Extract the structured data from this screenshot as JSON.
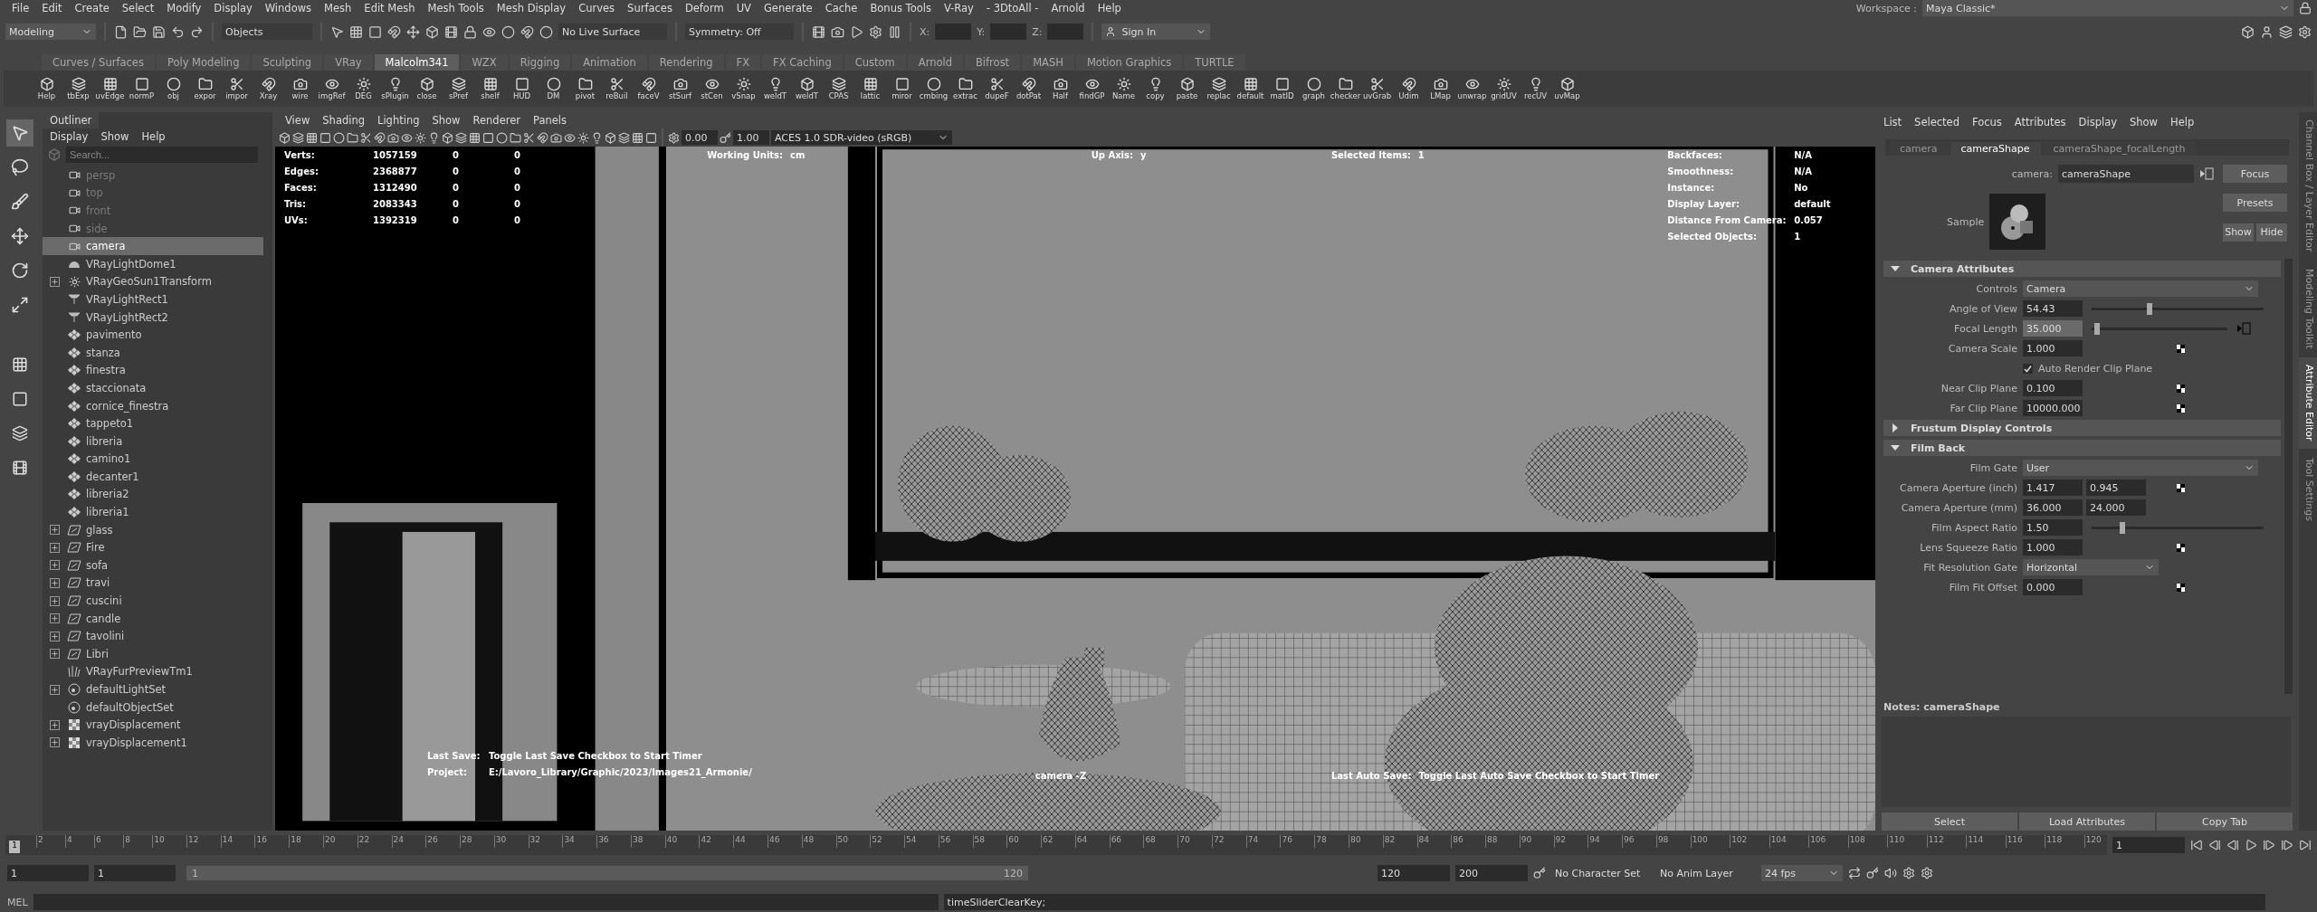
{
  "menu_bar": {
    "items": [
      "File",
      "Edit",
      "Create",
      "Select",
      "Modify",
      "Display",
      "Windows",
      "Mesh",
      "Edit Mesh",
      "Mesh Tools",
      "Mesh Display",
      "Curves",
      "Surfaces",
      "Deform",
      "UV",
      "Generate",
      "Cache",
      "Bonus Tools",
      "V-Ray",
      "- 3DtoAll -",
      "Arnold",
      "Help"
    ],
    "workspace_label": "Workspace :",
    "workspace": "Maya Classic*"
  },
  "status_line": {
    "mode": "Modeling",
    "selection": "Objects",
    "live_surface": "No Live Surface",
    "symmetry": "Symmetry: Off",
    "coords": [
      "X:",
      "Y:",
      "Z:"
    ],
    "sign_in": "Sign In"
  },
  "shelf_tabs": [
    {
      "label": "Curves / Surfaces",
      "selected": false
    },
    {
      "label": "Poly Modeling",
      "selected": false
    },
    {
      "label": "Sculpting",
      "selected": false
    },
    {
      "label": "VRay",
      "selected": false
    },
    {
      "label": "Malcolm341",
      "selected": true
    },
    {
      "label": "WZX",
      "selected": false
    },
    {
      "label": "Rigging",
      "selected": false
    },
    {
      "label": "Animation",
      "selected": false
    },
    {
      "label": "Rendering",
      "selected": false
    },
    {
      "label": "FX",
      "selected": false
    },
    {
      "label": "FX Caching",
      "selected": false
    },
    {
      "label": "Custom",
      "selected": false
    },
    {
      "label": "Arnold",
      "selected": false
    },
    {
      "label": "Bifrost",
      "selected": false
    },
    {
      "label": "MASH",
      "selected": false
    },
    {
      "label": "Motion Graphics",
      "selected": false
    },
    {
      "label": "TURTLE",
      "selected": false
    }
  ],
  "shelf_buttons": [
    "Help",
    "tbExp",
    "uvEdge",
    "normP",
    "obj",
    "expor",
    "impor",
    "Xray",
    "wire",
    "imgRef",
    "DEG",
    "sPlugin",
    "close",
    "sPref",
    "shelf",
    "HUD",
    "DM",
    "pivot",
    "reBuil",
    "faceV",
    "stSurf",
    "stCen",
    "vSnap",
    "weldT",
    "weldT",
    "CPAS",
    "lattic",
    "miror",
    "cmbing",
    "extrac",
    "dupeF",
    "dotPat",
    "Half",
    "findGP",
    "Name",
    "copy",
    "paste",
    "replac",
    "default",
    "matID",
    "graph",
    "checker",
    "uvGrab",
    "Udim",
    "LMap",
    "unwrap",
    "gridUV",
    "recUV",
    "uvMap"
  ],
  "outliner": {
    "title": "Outliner",
    "menu": [
      "Display",
      "Show",
      "Help"
    ],
    "search": {
      "placeholder": "Search..."
    },
    "items": [
      {
        "label": "persp",
        "kind": "camera",
        "has_children": false,
        "dimmed": true,
        "selected": false
      },
      {
        "label": "top",
        "kind": "camera",
        "has_children": false,
        "dimmed": true,
        "selected": false
      },
      {
        "label": "front",
        "kind": "camera",
        "has_children": false,
        "dimmed": true,
        "selected": false
      },
      {
        "label": "side",
        "kind": "camera",
        "has_children": false,
        "dimmed": true,
        "selected": false
      },
      {
        "label": "camera",
        "kind": "camera",
        "has_children": false,
        "dimmed": false,
        "selected": true
      },
      {
        "label": "VRayLightDome1",
        "kind": "dome",
        "has_children": false,
        "dimmed": false,
        "selected": false
      },
      {
        "label": "VRayGeoSun1Transform",
        "kind": "sun",
        "has_children": true,
        "dimmed": false,
        "selected": false
      },
      {
        "label": "VRayLightRect1",
        "kind": "rectlight",
        "has_children": false,
        "dimmed": false,
        "selected": false
      },
      {
        "label": "VRayLightRect2",
        "kind": "rectlight",
        "has_children": false,
        "dimmed": false,
        "selected": false
      },
      {
        "label": "pavimento",
        "kind": "mesh",
        "has_children": false,
        "dimmed": false,
        "selected": false
      },
      {
        "label": "stanza",
        "kind": "mesh",
        "has_children": false,
        "dimmed": false,
        "selected": false
      },
      {
        "label": "finestra",
        "kind": "mesh",
        "has_children": false,
        "dimmed": false,
        "selected": false
      },
      {
        "label": "staccionata",
        "kind": "mesh",
        "has_children": false,
        "dimmed": false,
        "selected": false
      },
      {
        "label": "cornice_finestra",
        "kind": "mesh",
        "has_children": false,
        "dimmed": false,
        "selected": false
      },
      {
        "label": "tappeto1",
        "kind": "mesh",
        "has_children": false,
        "dimmed": false,
        "selected": false
      },
      {
        "label": "libreria",
        "kind": "mesh",
        "has_children": false,
        "dimmed": false,
        "selected": false
      },
      {
        "label": "camino1",
        "kind": "mesh",
        "has_children": false,
        "dimmed": false,
        "selected": false
      },
      {
        "label": "decanter1",
        "kind": "mesh",
        "has_children": false,
        "dimmed": false,
        "selected": false
      },
      {
        "label": "libreria2",
        "kind": "mesh",
        "has_children": false,
        "dimmed": false,
        "selected": false
      },
      {
        "label": "libreria1",
        "kind": "mesh",
        "has_children": false,
        "dimmed": false,
        "selected": false
      },
      {
        "label": "glass",
        "kind": "group",
        "has_children": true,
        "dimmed": false,
        "selected": false
      },
      {
        "label": "Fire",
        "kind": "group",
        "has_children": true,
        "dimmed": false,
        "selected": false
      },
      {
        "label": "sofa",
        "kind": "group",
        "has_children": true,
        "dimmed": false,
        "selected": false
      },
      {
        "label": "travi",
        "kind": "group",
        "has_children": true,
        "dimmed": false,
        "selected": false
      },
      {
        "label": "cuscini",
        "kind": "group",
        "has_children": true,
        "dimmed": false,
        "selected": false
      },
      {
        "label": "candle",
        "kind": "group",
        "has_children": true,
        "dimmed": false,
        "selected": false
      },
      {
        "label": "tavolini",
        "kind": "group",
        "has_children": true,
        "dimmed": false,
        "selected": false
      },
      {
        "label": "Libri",
        "kind": "group",
        "has_children": true,
        "dimmed": false,
        "selected": false
      },
      {
        "label": "VRayFurPreviewTm1",
        "kind": "fur",
        "has_children": false,
        "dimmed": false,
        "selected": false
      },
      {
        "label": "defaultLightSet",
        "kind": "set",
        "has_children": true,
        "dimmed": false,
        "selected": false
      },
      {
        "label": "defaultObjectSet",
        "kind": "set",
        "has_children": false,
        "dimmed": false,
        "selected": false
      },
      {
        "label": "vrayDisplacement",
        "kind": "displacement",
        "has_children": true,
        "dimmed": false,
        "selected": false
      },
      {
        "label": "vrayDisplacement1",
        "kind": "displacement",
        "has_children": true,
        "dimmed": false,
        "selected": false
      }
    ]
  },
  "viewport": {
    "menu": [
      "View",
      "Shading",
      "Lighting",
      "Show",
      "Renderer",
      "Panels"
    ],
    "exposure": "0.00",
    "gamma": "1.00",
    "color_space": "ACES 1.0 SDR-video (sRGB)",
    "stats": [
      {
        "name": "Verts:",
        "values": [
          "1057159",
          "0",
          "0"
        ]
      },
      {
        "name": "Edges:",
        "values": [
          "2368877",
          "0",
          "0"
        ]
      },
      {
        "name": "Faces:",
        "values": [
          "1312490",
          "0",
          "0"
        ]
      },
      {
        "name": "Tris:",
        "values": [
          "2083343",
          "0",
          "0"
        ]
      },
      {
        "name": "UVs:",
        "values": [
          "1392319",
          "0",
          "0"
        ]
      }
    ],
    "top_hud": [
      {
        "name": "Working Units:",
        "value": "cm"
      },
      {
        "name": "Up Axis:",
        "value": "y"
      },
      {
        "name": "Selected Items:",
        "value": "1"
      }
    ],
    "right_hud": [
      {
        "name": "Backfaces:",
        "value": "N/A"
      },
      {
        "name": "Smoothness:",
        "value": "N/A"
      },
      {
        "name": "Instance:",
        "value": "No"
      },
      {
        "name": "Display Layer:",
        "value": "default"
      },
      {
        "name": "Distance From Camera:",
        "value": "0.057"
      },
      {
        "name": "Selected Objects:",
        "value": "1"
      }
    ],
    "last_save": {
      "name": "Last Save:",
      "value": "Toggle Last Save Checkbox to Start Timer"
    },
    "project": {
      "name": "Project:",
      "value": "E:/Lavoro_Library/Graphic/2023/Images21_Armonie/"
    },
    "camera_name": "camera -Z",
    "last_auto_save": {
      "name": "Last Auto Save:",
      "value": "Toggle Last Auto Save Checkbox to Start Timer"
    }
  },
  "attribute_editor": {
    "menu": [
      "List",
      "Selected",
      "Focus",
      "Attributes",
      "Display",
      "Show",
      "Help"
    ],
    "tabs": [
      {
        "label": "camera",
        "selected": false
      },
      {
        "label": "cameraShape",
        "selected": true
      },
      {
        "label": "cameraShape_focalLength",
        "selected": false
      }
    ],
    "node_label": "camera:",
    "node_value": "cameraShape",
    "buttons": [
      "Focus",
      "Presets",
      "Show",
      "Hide"
    ],
    "sample_label": "Sample",
    "sections": [
      {
        "title": "Camera Attributes",
        "expanded": true,
        "rows": [
          {
            "kind": "dropdown",
            "label": "Controls",
            "value": "Camera"
          },
          {
            "kind": "slider",
            "label": "Angle of View",
            "value": "54.43",
            "level": 0.33,
            "keyed": false
          },
          {
            "kind": "slider",
            "label": "Focal Length",
            "value": "35.000",
            "level": 0.02,
            "keyed": true
          },
          {
            "kind": "field",
            "label": "Camera Scale",
            "values": [
              "1.000"
            ],
            "checker": true
          },
          {
            "kind": "checkbox",
            "label": "Auto Render Clip Plane",
            "checked": true
          },
          {
            "kind": "field",
            "label": "Near Clip Plane",
            "values": [
              "0.100"
            ],
            "checker": true
          },
          {
            "kind": "field",
            "label": "Far Clip Plane",
            "values": [
              "10000.000"
            ],
            "checker": true
          }
        ]
      },
      {
        "title": "Frustum Display Controls",
        "expanded": false
      },
      {
        "title": "Film Back",
        "expanded": true,
        "rows": [
          {
            "kind": "dropdown",
            "label": "Film Gate",
            "value": "User"
          },
          {
            "kind": "field",
            "label": "Camera Aperture (inch)",
            "values": [
              "1.417",
              "0.945"
            ],
            "checker": true
          },
          {
            "kind": "field",
            "label": "Camera Aperture (mm)",
            "values": [
              "36.000",
              "24.000"
            ],
            "checker": false
          },
          {
            "kind": "slider",
            "label": "Film Aspect Ratio",
            "value": "1.50",
            "level": 0.17,
            "keyed": false
          },
          {
            "kind": "field",
            "label": "Lens Squeeze Ratio",
            "values": [
              "1.000"
            ],
            "checker": true
          },
          {
            "kind": "dropdown",
            "label": "Fit Resolution Gate",
            "value": "Horizontal"
          },
          {
            "kind": "field",
            "label": "Film Fit Offset",
            "values": [
              "0.000"
            ],
            "checker": true
          }
        ]
      }
    ],
    "notes": "Notes:  cameraShape",
    "bottom_buttons": [
      "Select",
      "Load Attributes",
      "Copy Tab"
    ]
  },
  "side_tabs": [
    {
      "label": "Channel Box / Layer Editor",
      "selected": false
    },
    {
      "label": "Modeling Toolkit",
      "selected": false
    },
    {
      "label": "Attribute Editor",
      "selected": true
    },
    {
      "label": "Tool Settings",
      "selected": false
    }
  ],
  "timeline": {
    "current": "1",
    "level": 0,
    "ticks": [
      "2",
      "4",
      "6",
      "8",
      "10",
      "12",
      "14",
      "16",
      "18",
      "20",
      "22",
      "24",
      "26",
      "28",
      "30",
      "32",
      "34",
      "36",
      "38",
      "40",
      "42",
      "44",
      "46",
      "48",
      "50",
      "52",
      "54",
      "56",
      "58",
      "60",
      "62",
      "64",
      "66",
      "68",
      "70",
      "72",
      "74",
      "76",
      "78",
      "80",
      "82",
      "84",
      "86",
      "88",
      "90",
      "92",
      "94",
      "96",
      "98",
      "100",
      "102",
      "104",
      "106",
      "108",
      "110",
      "112",
      "114",
      "116",
      "118",
      "120"
    ],
    "frame_field": "1"
  },
  "range": {
    "start": "1",
    "playback_start": "1",
    "slider_start": "1",
    "slider_end": "120",
    "level": 1,
    "playback_end": "120",
    "end": "200",
    "character_set": "No Character Set",
    "anim_layer": "No Anim Layer",
    "fps": "24 fps"
  },
  "command_line": {
    "label": "MEL",
    "output": "timeSliderClearKey;"
  }
}
